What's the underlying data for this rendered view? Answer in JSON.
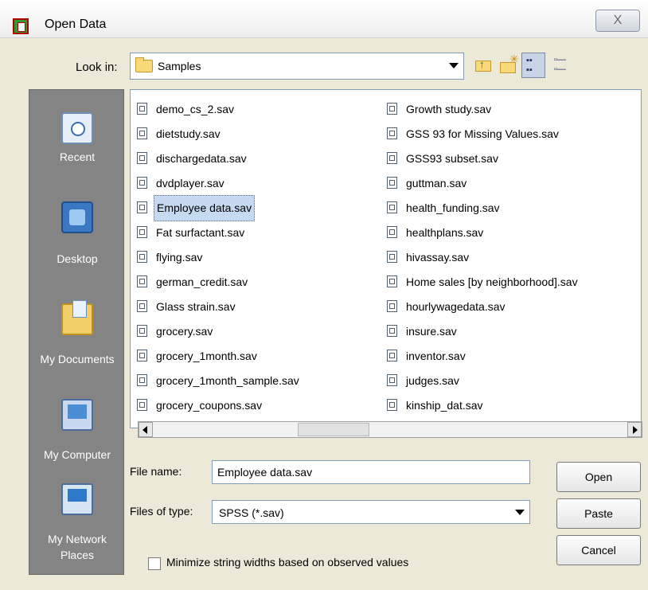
{
  "window": {
    "title": "Open Data",
    "close_label": "X"
  },
  "lookin": {
    "label": "Look in:",
    "value": "Samples"
  },
  "places": [
    {
      "label": "Recent",
      "icon": "recent-icon"
    },
    {
      "label": "Desktop",
      "icon": "desktop-icon"
    },
    {
      "label": "My Documents",
      "icon": "my-documents-icon"
    },
    {
      "label": "My Computer",
      "icon": "my-computer-icon"
    },
    {
      "label": "My Network Places",
      "icon": "my-network-places-icon"
    }
  ],
  "files": {
    "column1": [
      "demo_cs_2.sav",
      "dietstudy.sav",
      "dischargedata.sav",
      "dvdplayer.sav",
      "Employee data.sav",
      "Fat surfactant.sav",
      "flying.sav",
      "german_credit.sav",
      "Glass strain.sav",
      "grocery.sav",
      "grocery_1month.sav",
      "grocery_1month_sample.sav",
      "grocery_coupons.sav"
    ],
    "column2": [
      "Growth study.sav",
      "GSS 93 for Missing Values.sav",
      "GSS93 subset.sav",
      "guttman.sav",
      "health_funding.sav",
      "healthplans.sav",
      "hivassay.sav",
      "Home sales [by neighborhood].sav",
      "hourlywagedata.sav",
      "insure.sav",
      "inventor.sav",
      "judges.sav",
      "kinship_dat.sav"
    ],
    "selected": "Employee data.sav"
  },
  "filename": {
    "label": "File name:",
    "value": "Employee data.sav"
  },
  "filetype": {
    "label": "Files of type:",
    "value": "SPSS (*.sav)"
  },
  "buttons": {
    "open": "Open",
    "paste": "Paste",
    "cancel": "Cancel"
  },
  "checkbox": {
    "label": "Minimize string widths based on observed values",
    "checked": false
  }
}
